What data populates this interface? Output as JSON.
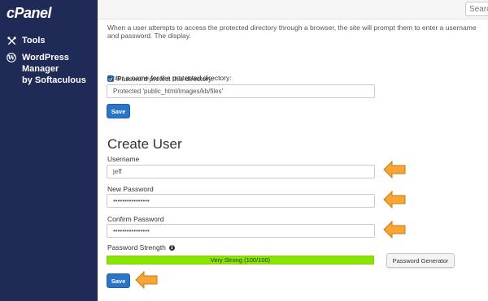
{
  "sidebar": {
    "logo": "cPanel",
    "items": [
      {
        "label": "Tools",
        "icon": "tools-icon"
      },
      {
        "label_line1": "WordPress Manager",
        "label_line2": "by Softaculous",
        "icon": "wordpress-icon"
      }
    ]
  },
  "topbar": {
    "search_placeholder": "Search"
  },
  "protect": {
    "intro": "When a user attempts to access the protected directory through a browser, the site will prompt them to enter a username and password. The display.",
    "checkbox_label": "Password protect this directory.",
    "checkbox_checked": true,
    "name_label": "Enter a name for the protected directory:",
    "name_value": "Protected 'public_html/images/kb/files'",
    "save_label": "Save"
  },
  "create_user": {
    "title": "Create User",
    "username_label": "Username",
    "username_value": "jeff",
    "new_password_label": "New Password",
    "new_password_value": "••••••••••••••••",
    "confirm_password_label": "Confirm Password",
    "confirm_password_value": "••••••••••••••••",
    "strength_label": "Password Strength",
    "strength_text": "Very Strong (100/100)",
    "strength_value": 100,
    "generator_label": "Password Generator",
    "save_label": "Save"
  },
  "colors": {
    "sidebar_bg": "#1f2a56",
    "primary_button": "#2a75c7",
    "strength_fill": "#83e800",
    "arrow_fill": "#f7a534"
  }
}
